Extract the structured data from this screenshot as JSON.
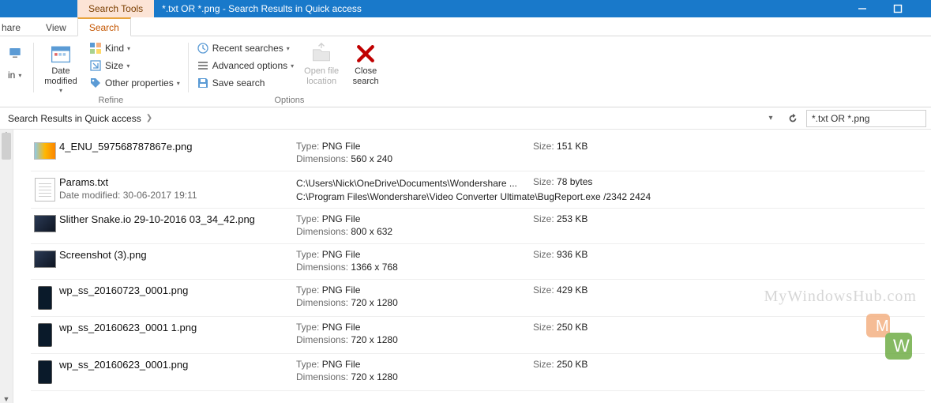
{
  "titlebar": {
    "tool_tab": "Search Tools",
    "title": "*.txt OR *.png - Search Results in Quick access"
  },
  "tabs": {
    "share": "hare",
    "view": "View",
    "search": "Search"
  },
  "ribbon": {
    "location_group": {
      "in_label": "in",
      "label": ""
    },
    "refine_group": {
      "date_modified": "Date\nmodified",
      "kind": "Kind",
      "size": "Size",
      "other_properties": "Other properties",
      "label": "Refine"
    },
    "options_group": {
      "recent_searches": "Recent searches",
      "advanced_options": "Advanced options",
      "save_search": "Save search",
      "open_file_location": "Open file\nlocation",
      "close_search": "Close\nsearch",
      "label": "Options"
    }
  },
  "address": {
    "breadcrumb": "Search Results in Quick access",
    "search_value": "*.txt OR *.png"
  },
  "labels": {
    "type": "Type:",
    "dimensions": "Dimensions:",
    "size": "Size:",
    "date_modified": "Date modified:"
  },
  "results": [
    {
      "icon": "pic",
      "name": "4_ENU_597568787867e.png",
      "type": "PNG File",
      "dimensions": "560 x 240",
      "size": "151 KB"
    },
    {
      "icon": "txt",
      "name": "Params.txt",
      "date_modified": "30-06-2017 19:11",
      "path1": "C:\\Users\\Nick\\OneDrive\\Documents\\Wondershare ...",
      "path2": "C:\\Program Files\\Wondershare\\Video Converter Ultimate\\BugReport.exe /2342 2424",
      "size": "78 bytes"
    },
    {
      "icon": "dark",
      "name": "Slither Snake.io 29-10-2016 03_34_42.png",
      "type": "PNG File",
      "dimensions": "800 x 632",
      "size": "253 KB"
    },
    {
      "icon": "dark",
      "name": "Screenshot (3).png",
      "type": "PNG File",
      "dimensions": "1366 x 768",
      "size": "936 KB"
    },
    {
      "icon": "phone",
      "name": "wp_ss_20160723_0001.png",
      "type": "PNG File",
      "dimensions": "720 x 1280",
      "size": "429 KB"
    },
    {
      "icon": "phone",
      "name": "wp_ss_20160623_0001 1.png",
      "type": "PNG File",
      "dimensions": "720 x 1280",
      "size": "250 KB"
    },
    {
      "icon": "phone",
      "name": "wp_ss_20160623_0001.png",
      "type": "PNG File",
      "dimensions": "720 x 1280",
      "size": "250 KB"
    }
  ],
  "watermark": "MyWindowsHub.com"
}
